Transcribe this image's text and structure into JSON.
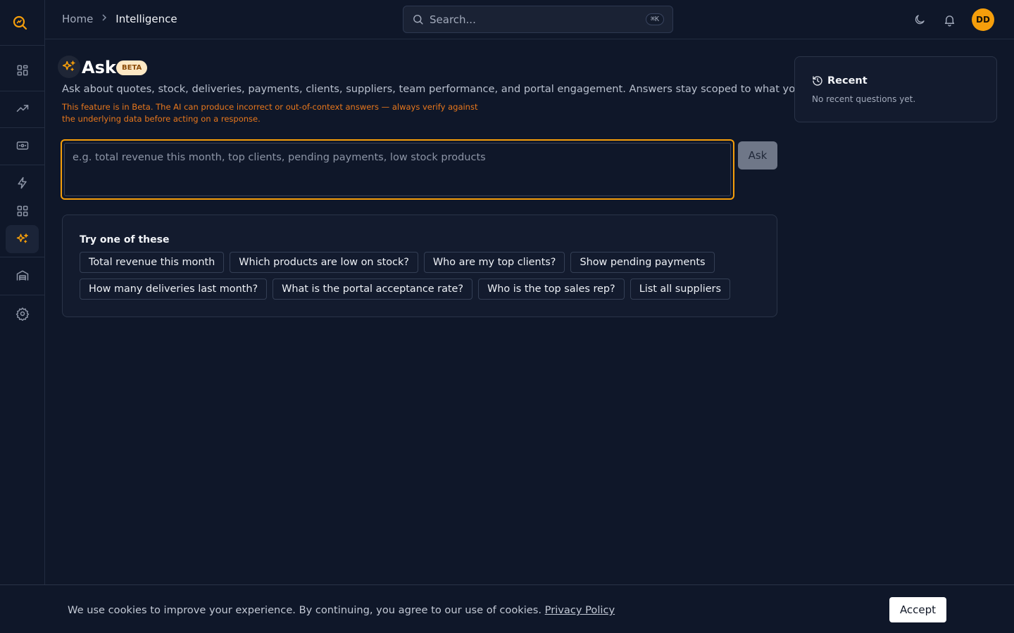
{
  "colors": {
    "accent": "#f59e0b",
    "background": "#0f1729",
    "card": "#131b2e",
    "warning": "#e8771c"
  },
  "sidebar": {
    "logo_icon": "search-logo-icon",
    "items": [
      {
        "name": "dashboard",
        "icon": "grid-icon"
      },
      {
        "name": "analytics",
        "icon": "trending-up-icon"
      },
      {
        "name": "payments",
        "icon": "cash-icon"
      },
      {
        "name": "automation",
        "icon": "lightning-icon"
      },
      {
        "name": "apps",
        "icon": "grid-icon"
      },
      {
        "name": "intelligence",
        "icon": "sparkles-icon",
        "active": true
      },
      {
        "name": "warehouse",
        "icon": "warehouse-icon"
      },
      {
        "name": "settings",
        "icon": "gear-icon"
      }
    ]
  },
  "header": {
    "breadcrumb": {
      "home": "Home",
      "current": "Intelligence"
    },
    "search_placeholder": "Search...",
    "shortcut": "⌘K",
    "avatar_initials": "DD"
  },
  "main": {
    "title": "Ask",
    "badge": "BETA",
    "subtitle": "Ask about quotes, stock, deliveries, payments, clients, suppliers, team performance, and portal engagement. Answers stay scoped to what you can see.",
    "warning_line1": "This feature is in Beta. The AI can produce incorrect or out-of-context answers — always verify against",
    "warning_line2": "the underlying data before acting on a response.",
    "input_placeholder": "e.g. total revenue this month, top clients, pending payments, low stock products",
    "ask_label": "Ask",
    "suggestions_title": "Try one of these",
    "suggestions": [
      "Total revenue this month",
      "Which products are low on stock?",
      "Who are my top clients?",
      "Show pending payments",
      "How many deliveries last month?",
      "What is the portal acceptance rate?",
      "Who is the top sales rep?",
      "List all suppliers"
    ]
  },
  "recent": {
    "title": "Recent",
    "empty_text": "No recent questions yet."
  },
  "cookie": {
    "text": "We use cookies to improve your experience. By continuing, you agree to our use of cookies.",
    "link": "Privacy Policy",
    "accept_label": "Accept"
  }
}
